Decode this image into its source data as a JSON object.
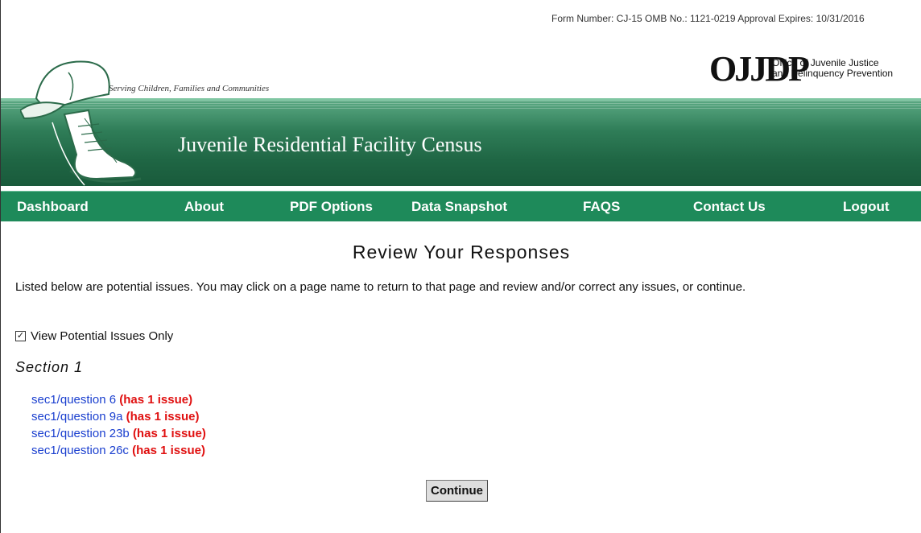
{
  "header": {
    "form_number": "Form Number: CJ-15 OMB No.: 1121-0219 Approval Expires: 10/31/2016",
    "tagline": "Serving Children, Families and Communities",
    "agency_logo": "OJJDP",
    "agency_name_line1": "Office of Juvenile Justice",
    "agency_name_line2": "and Delinquency Prevention",
    "banner_title": "Juvenile Residential Facility Census"
  },
  "nav": {
    "items": [
      {
        "label": "Dashboard"
      },
      {
        "label": "About"
      },
      {
        "label": "PDF Options"
      },
      {
        "label": "Data Snapshot"
      },
      {
        "label": "FAQS"
      },
      {
        "label": "Contact Us"
      },
      {
        "label": "Logout"
      }
    ]
  },
  "main": {
    "title": "Review Your Responses",
    "intro": "Listed below are potential issues. You may click on a page name to return to that page and review and/or correct any issues, or continue.",
    "filter_checkbox": {
      "label": "View Potential Issues Only",
      "checked": true
    },
    "section_title": "Section 1",
    "issues": [
      {
        "page": "sec1/question 6",
        "count": "(has 1 issue)"
      },
      {
        "page": "sec1/question 9a",
        "count": "(has 1 issue)"
      },
      {
        "page": "sec1/question 23b",
        "count": "(has 1 issue)"
      },
      {
        "page": "sec1/question 26c",
        "count": "(has 1 issue)"
      }
    ],
    "continue_label": "Continue"
  },
  "colors": {
    "nav_bg": "#1e8a5a",
    "link": "#1a3fcf",
    "issue": "#e01010"
  }
}
